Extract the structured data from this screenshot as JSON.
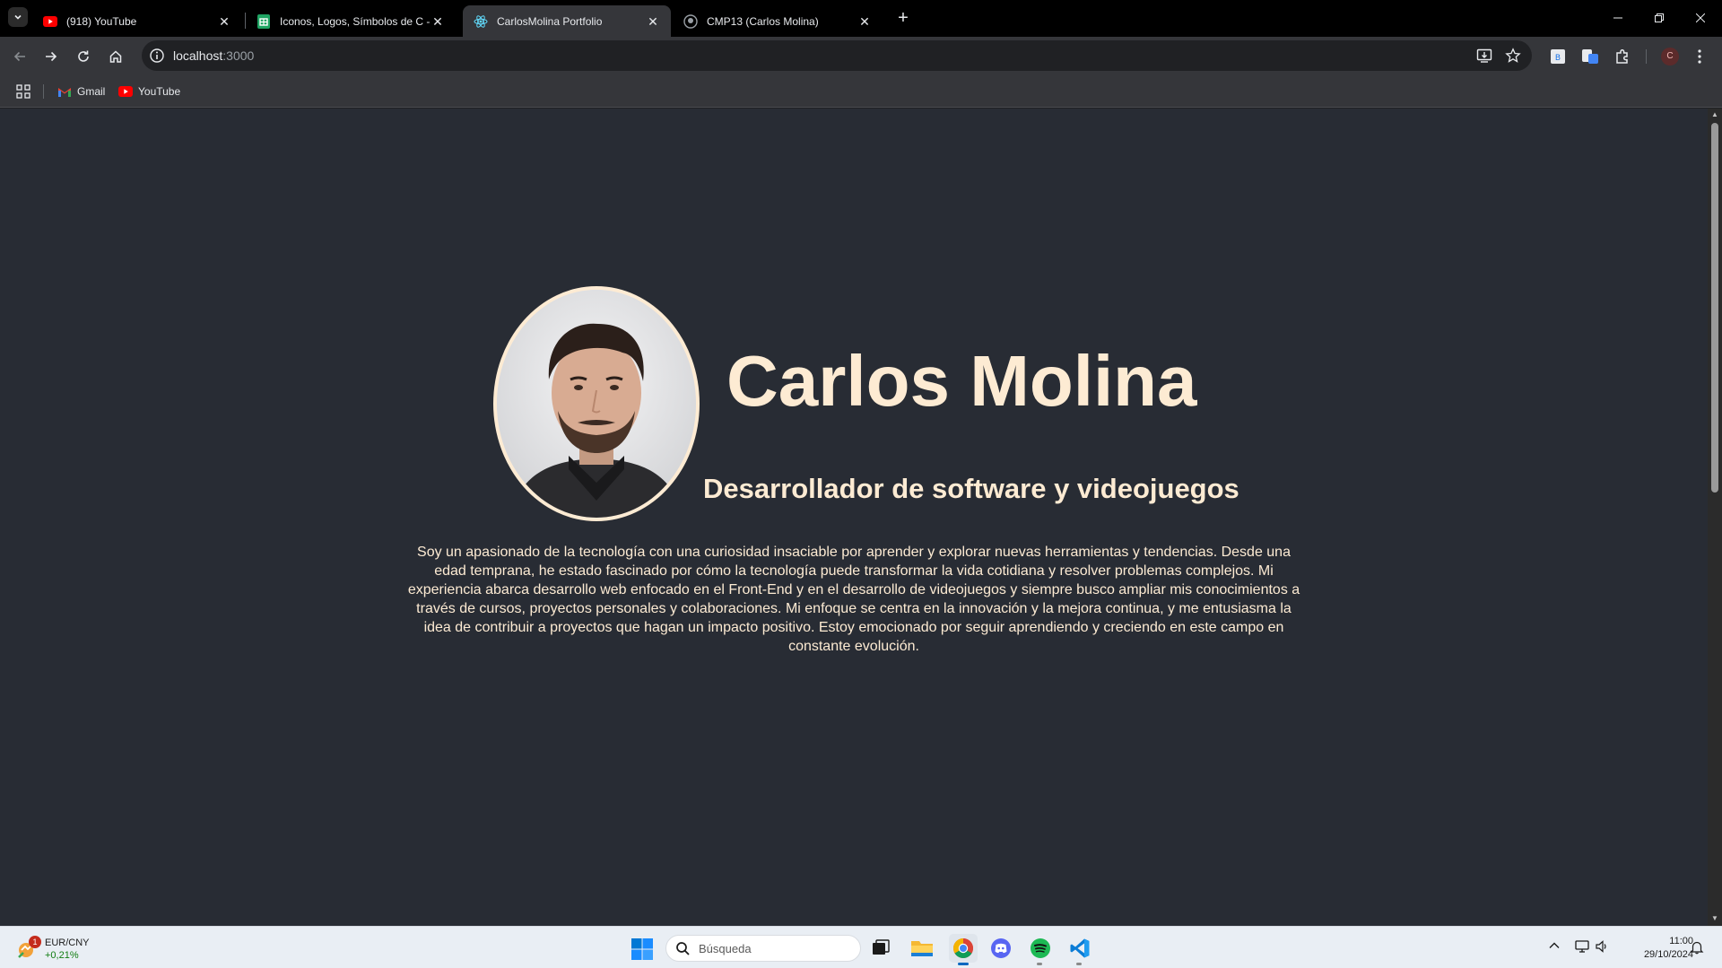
{
  "browser": {
    "tabs": [
      {
        "title": "(918) YouTube",
        "icon": "youtube-icon"
      },
      {
        "title": "Iconos, Logos, Símbolos de C -",
        "icon": "sheets-icon"
      },
      {
        "title": "CarlosMolina Portfolio",
        "icon": "react-icon",
        "active": true
      },
      {
        "title": "CMP13 (Carlos Molina)",
        "icon": "github-icon"
      }
    ],
    "url_host": "localhost",
    "url_port": ":3000",
    "bookmarks": [
      {
        "label": "Gmail",
        "icon": "gmail-icon"
      },
      {
        "label": "YouTube",
        "icon": "youtube-icon"
      }
    ],
    "profile_initial": "C"
  },
  "page": {
    "name": "Carlos Molina",
    "subtitle": "Desarrollador de software y videojuegos",
    "bio": "Soy un apasionado de la tecnología con una curiosidad insaciable por aprender y explorar nuevas herramientas y tendencias. Desde una edad temprana, he estado fascinado por cómo la tecnología puede transformar la vida cotidiana y resolver problemas complejos. Mi experiencia abarca desarrollo web enfocado en el Front-End y en el desarrollo de videojuegos y siempre busco ampliar mis conocimientos a través de cursos, proyectos personales y colaboraciones. Mi enfoque se centra en la innovación y la mejora continua, y me entusiasma la idea de contribuir a proyectos que hagan un impacto positivo. Estoy emocionado por seguir aprendiendo y creciendo en este campo en constante evolución.",
    "colors": {
      "background": "#282c34",
      "text": "#fdebd3"
    }
  },
  "taskbar": {
    "widget_badge": "1",
    "widget_title": "EUR/CNY",
    "widget_value": "+0,21%",
    "search_placeholder": "Búsqueda",
    "time": "11:00",
    "date": "29/10/2024",
    "apps": [
      "task-view-icon",
      "file-explorer-icon",
      "chrome-icon",
      "discord-icon",
      "spotify-icon",
      "vscode-icon"
    ]
  }
}
